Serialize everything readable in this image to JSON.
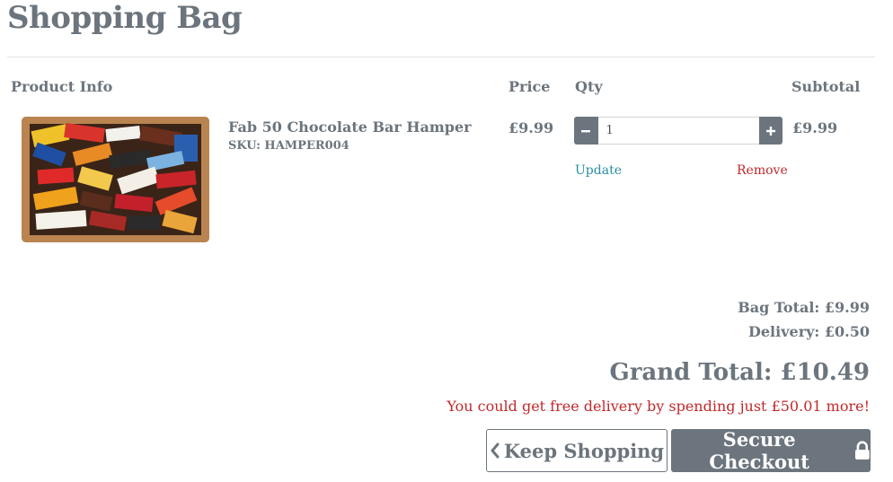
{
  "page": {
    "title": "Shopping Bag"
  },
  "table": {
    "headers": {
      "product": "Product Info",
      "price": "Price",
      "qty": "Qty",
      "subtotal": "Subtotal"
    }
  },
  "item": {
    "name": "Fab 50 Chocolate Bar Hamper",
    "sku": "SKU: HAMPER004",
    "price": "£9.99",
    "quantity": "1",
    "subtotal": "£9.99",
    "update_label": "Update",
    "remove_label": "Remove",
    "image_icon": "chocolate-hamper-photo"
  },
  "totals": {
    "bag_total": "Bag Total: £9.99",
    "delivery": "Delivery: £0.50",
    "grand_total": "Grand Total: £10.49",
    "free_delivery_message": "You could get free delivery by spending just £50.01 more!"
  },
  "actions": {
    "keep_shopping_label": "Keep Shopping",
    "secure_checkout_label": "Secure Checkout"
  },
  "colors": {
    "text_grey": "#6c757d",
    "link_teal": "#2a8ea3",
    "alert_red": "#c0292b",
    "button_grey": "#6c757d"
  }
}
